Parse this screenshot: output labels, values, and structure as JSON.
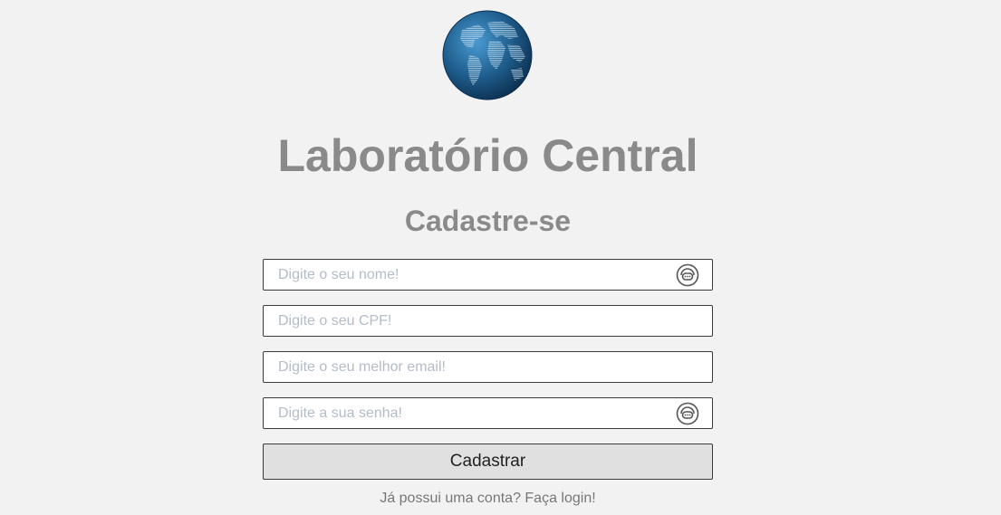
{
  "header": {
    "logo": "globe-logo",
    "title": "Laboratório Central",
    "subtitle": "Cadastre-se"
  },
  "form": {
    "name_placeholder": "Digite o seu nome!",
    "cpf_placeholder": "Digite o seu CPF!",
    "email_placeholder": "Digite o seu melhor email!",
    "password_placeholder": "Digite a sua senha!",
    "autofill_icon": "password-manager-icon",
    "submit_label": "Cadastrar",
    "login_link": "Já possui uma conta? Faça login!"
  },
  "colors": {
    "background": "#f2f2f2",
    "heading": "#8a8a8a",
    "placeholder": "#b4bcc8",
    "button_bg": "#e0e0e0",
    "globe": "#1f5f8f"
  }
}
